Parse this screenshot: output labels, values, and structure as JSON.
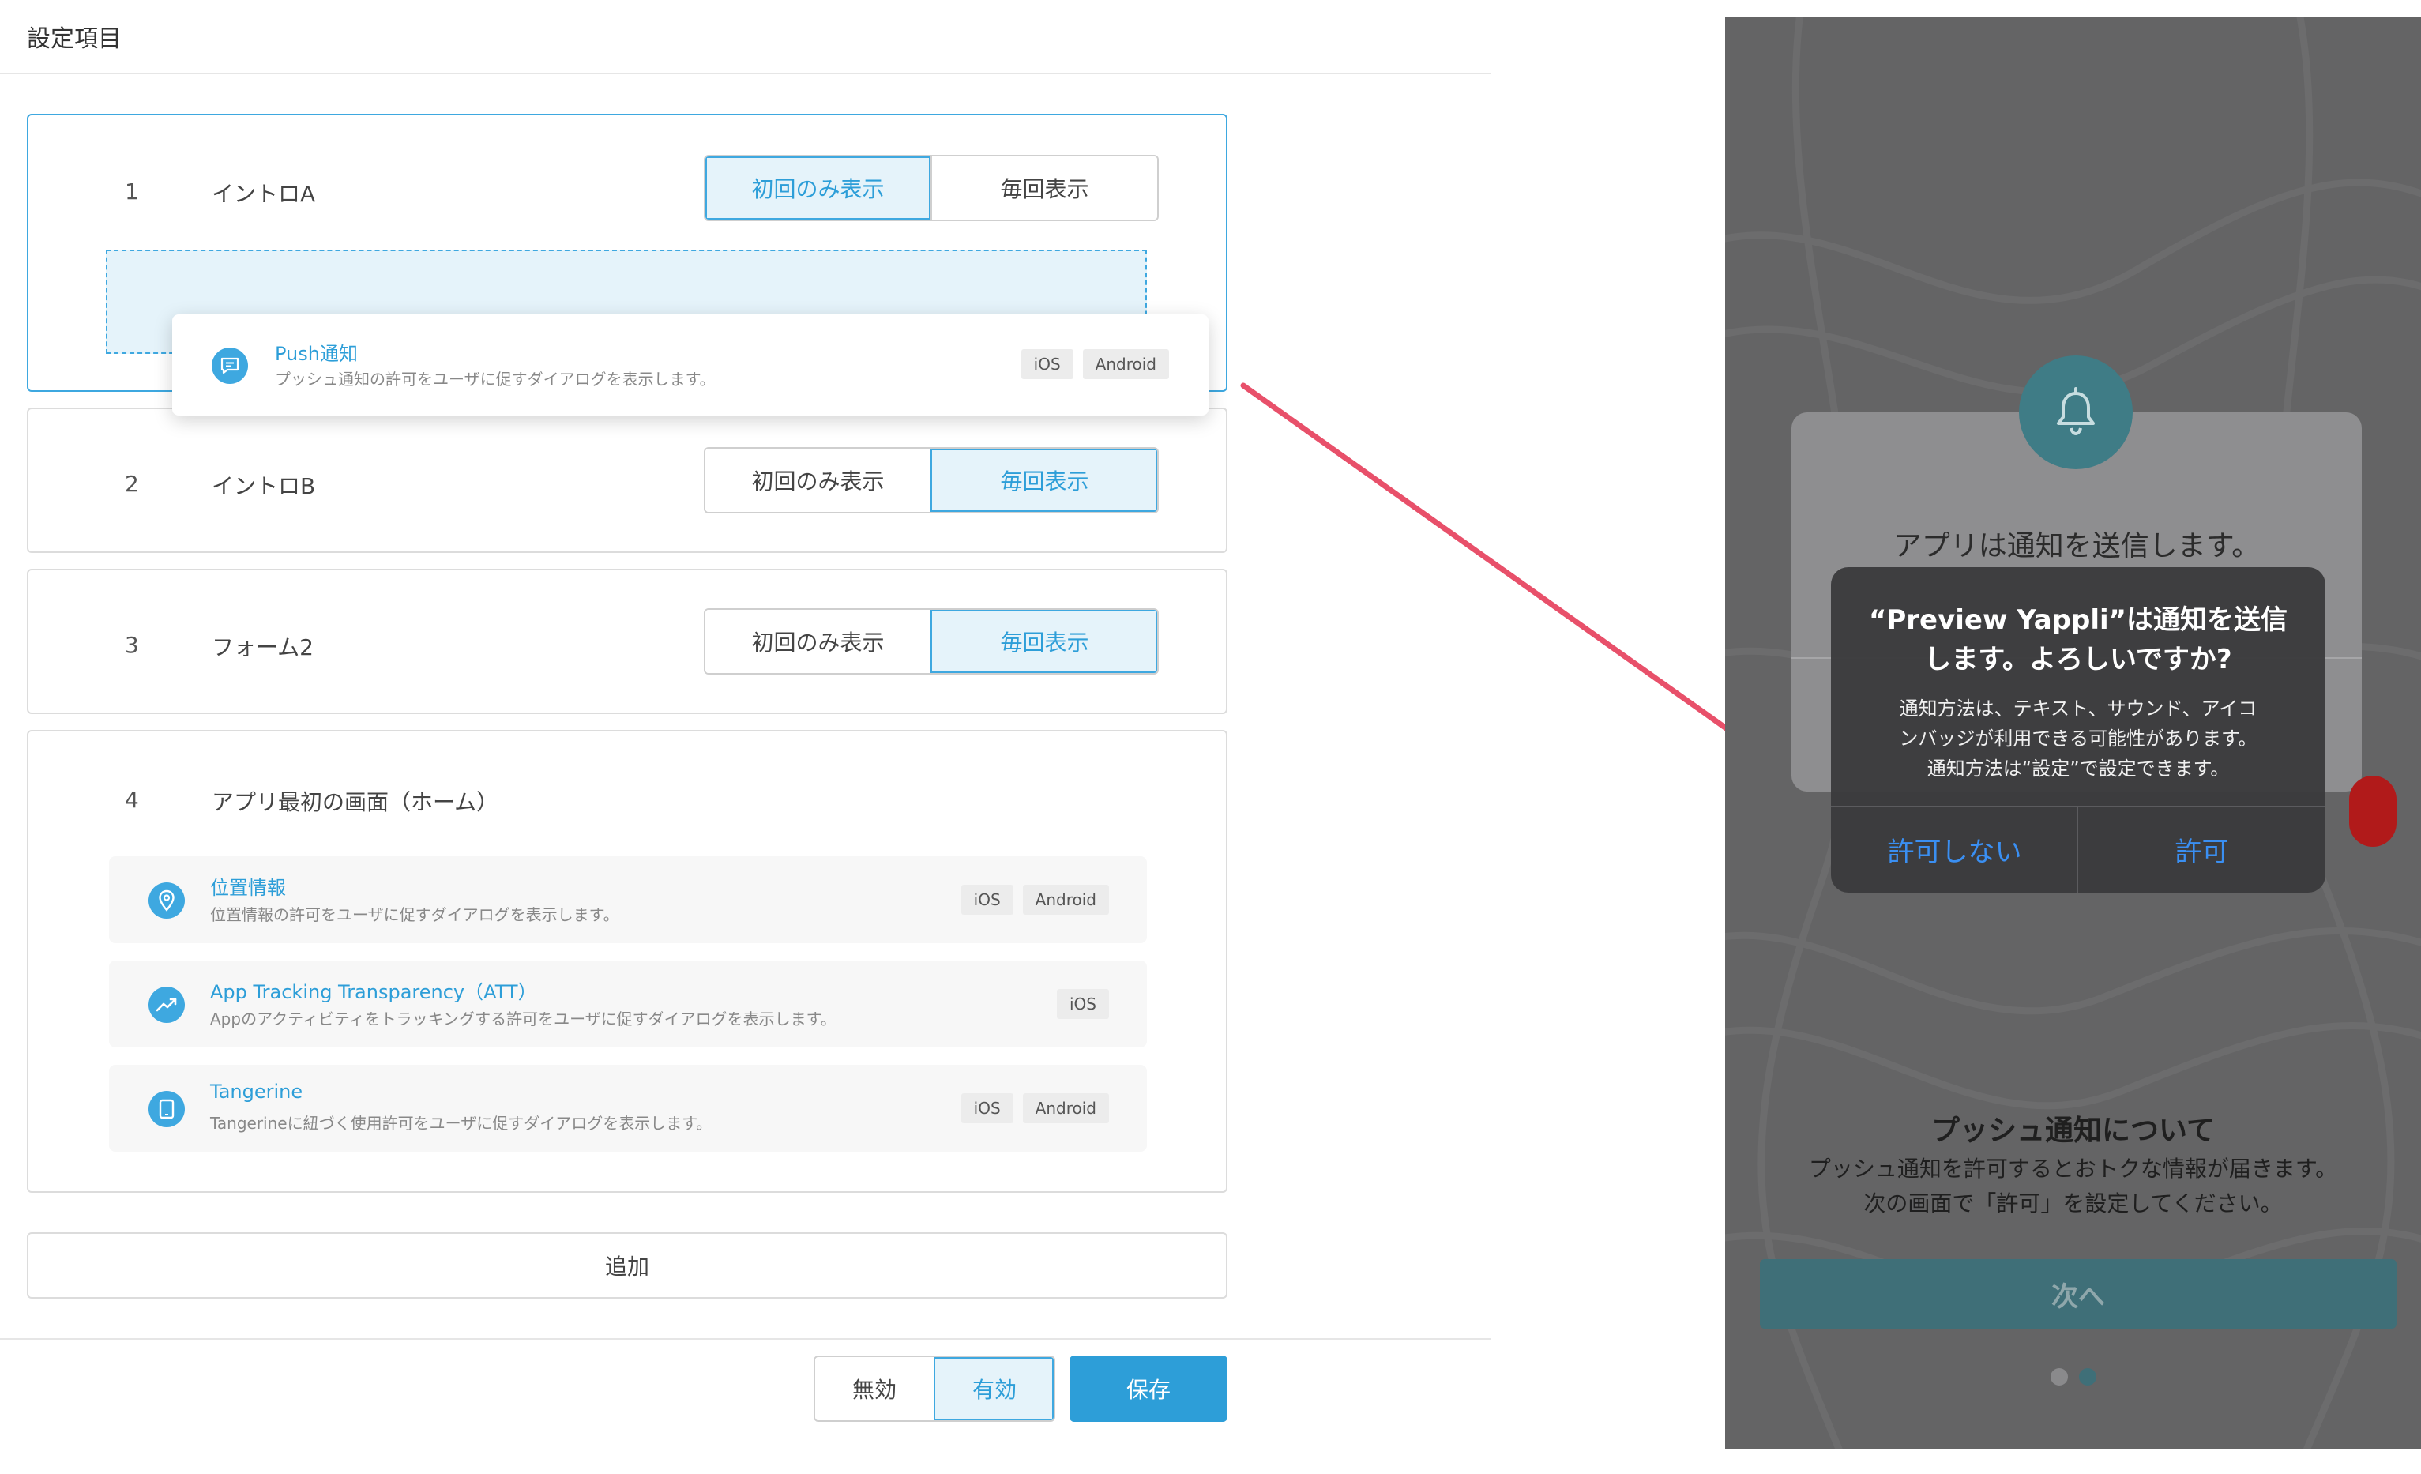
{
  "editor": {
    "title": "設定項目",
    "cards": [
      {
        "num": "1",
        "title": "イントロA",
        "options": [
          "初回のみ表示",
          "毎回表示"
        ],
        "selected": 0
      },
      {
        "num": "2",
        "title": "イントロB",
        "options": [
          "初回のみ表示",
          "毎回表示"
        ],
        "selected": 1
      },
      {
        "num": "3",
        "title": "フォーム2",
        "options": [
          "初回のみ表示",
          "毎回表示"
        ],
        "selected": 1
      },
      {
        "num": "4",
        "title": "アプリ最初の画面（ホーム）"
      }
    ],
    "dragging_item": {
      "name": "Push通知",
      "desc": "プッシュ通知の許可をユーザに促すダイアログを表示します。",
      "platforms": [
        "iOS",
        "Android"
      ],
      "icon": "chat-bubble-icon"
    },
    "items": [
      {
        "name": "位置情報",
        "desc": "位置情報の許可をユーザに促すダイアログを表示します。",
        "platforms": [
          "iOS",
          "Android"
        ],
        "icon": "location-pin-icon"
      },
      {
        "name": "App Tracking Transparency（ATT）",
        "desc": "Appのアクティビティをトラッキングする許可をユーザに促すダイアログを表示します。",
        "platforms": [
          "iOS"
        ],
        "icon": "trend-line-icon"
      },
      {
        "name": "Tangerine",
        "desc": "Tangerineに紐づく使用許可をユーザに促すダイアログを表示します。",
        "platforms": [
          "iOS",
          "Android"
        ],
        "icon": "tablet-icon"
      }
    ],
    "add_label": "追加",
    "toggle": {
      "options": [
        "無効",
        "有効"
      ],
      "selected": 1
    },
    "save_label": "保存"
  },
  "preview": {
    "intro_text": "アプリは通知を送信します。",
    "alert": {
      "title_line1": "“Preview Yappli”は通知を送信",
      "title_line2": "します。よろしいですか?",
      "msg_line1": "通知方法は、テキスト、サウンド、アイコ",
      "msg_line2": "ンバッジが利用できる可能性があります。",
      "msg_line3": "通知方法は“設定”で設定できます。",
      "deny": "許可しない",
      "allow": "許可"
    },
    "push_title": "プッシュ通知について",
    "push_desc_line1": "プッシュ通知を許可するとおトクな情報が届きます。",
    "push_desc_line2": "次の画面で「許可」を設定してください。",
    "next_label": "次へ",
    "page_dots": 2,
    "active_dot": 1
  },
  "colors": {
    "accent": "#2d9ed8",
    "selected_bg": "#e5f3fa",
    "arrow": "#e8506a",
    "ios_button": "#3a8ff2",
    "teal": "#3f7c86"
  }
}
